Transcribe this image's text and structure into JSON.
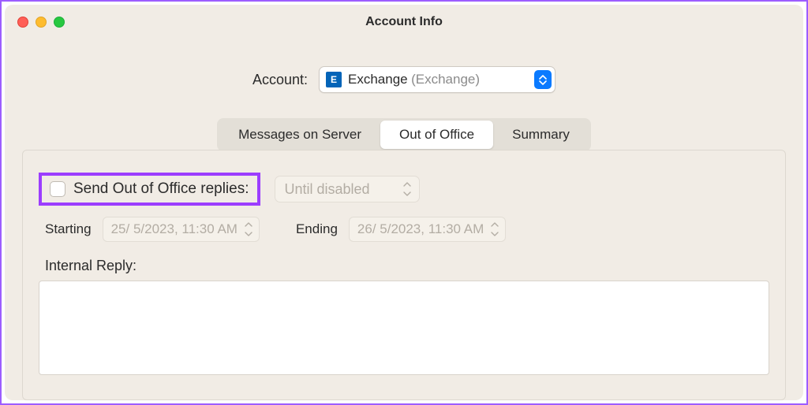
{
  "window": {
    "title": "Account Info"
  },
  "account": {
    "label": "Account:",
    "selected_name": "Exchange",
    "selected_type": "(Exchange)"
  },
  "tabs": {
    "items": [
      {
        "label": "Messages on Server"
      },
      {
        "label": "Out of Office"
      },
      {
        "label": "Summary"
      }
    ],
    "active_index": 1
  },
  "ooo": {
    "checkbox_label": "Send Out of Office replies:",
    "duration_value": "Until disabled",
    "starting_label": "Starting",
    "starting_value": "25/  5/2023, 11:30 AM",
    "ending_label": "Ending",
    "ending_value": "26/  5/2023, 11:30 AM",
    "internal_reply_label": "Internal Reply:"
  },
  "colors": {
    "highlight": "#9c3dff",
    "accent": "#0a7aff",
    "window_bg": "#f1ece5"
  }
}
